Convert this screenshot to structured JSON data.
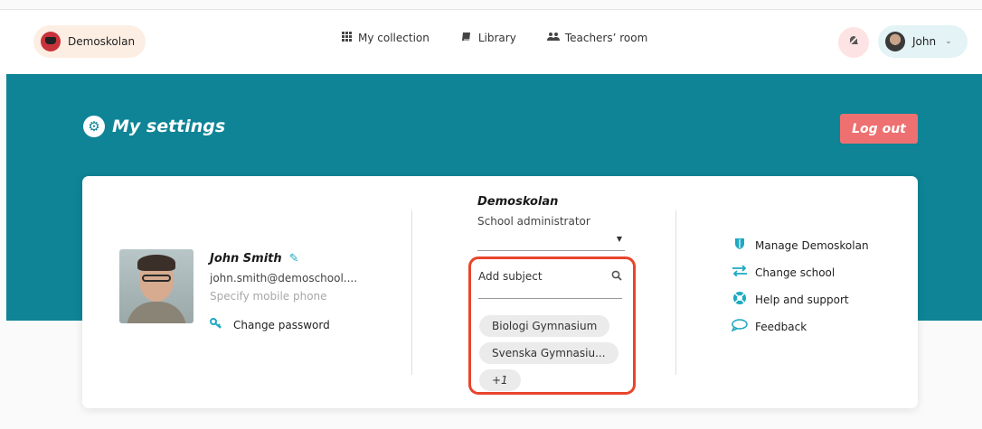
{
  "header": {
    "school": "Demoskolan",
    "nav": [
      {
        "label": "My collection",
        "icon": "grid-icon"
      },
      {
        "label": "Library",
        "icon": "book-icon"
      },
      {
        "label": "Teachers’ room",
        "icon": "users-icon"
      }
    ],
    "user_name": "John"
  },
  "banner": {
    "title": "My settings",
    "logout_label": "Log out"
  },
  "profile": {
    "name": "John Smith",
    "email": "john.smith@demoschool....",
    "phone_placeholder": "Specify mobile phone",
    "change_password": "Change password"
  },
  "school": {
    "name": "Demoskolan",
    "role": "School administrator",
    "subject_placeholder": "Add subject",
    "subjects": [
      "Biologi Gymnasium",
      "Svenska Gymnasiu...",
      "+1"
    ]
  },
  "links": [
    {
      "label": "Manage Demoskolan",
      "icon": "shield-icon"
    },
    {
      "label": "Change school",
      "icon": "swap-arrows-icon"
    },
    {
      "label": "Help and support",
      "icon": "lifebuoy-icon"
    },
    {
      "label": "Feedback",
      "icon": "speech-bubble-icon"
    }
  ],
  "colors": {
    "banner": "#0e8496",
    "accent": "#1da9c2",
    "logout": "#ee7070",
    "highlight": "#e8452c"
  }
}
